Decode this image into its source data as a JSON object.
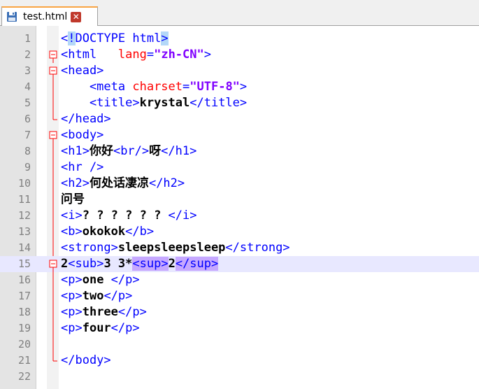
{
  "tab": {
    "label": "test.html",
    "close_glyph": "✕",
    "icon": "save-disk-icon"
  },
  "colors": {
    "tag": "#0000ff",
    "attribute": "#ff0000",
    "value": "#8000ff",
    "fold": "#ff0000",
    "current_line": "#e8e8ff"
  },
  "editor": {
    "current_line": 15,
    "lines": [
      {
        "n": "1",
        "fold": "",
        "segments": [
          {
            "c": "tg",
            "t": "<"
          },
          {
            "c": "tg hlbracket",
            "t": "!"
          },
          {
            "c": "tg",
            "t": ""
          },
          {
            "c": "tg",
            "t": "DOCTYPE html"
          },
          {
            "c": "tg hlbracket",
            "t": ">"
          }
        ]
      },
      {
        "n": "2",
        "fold": "box",
        "segments": [
          {
            "c": "tg",
            "t": "<html   "
          },
          {
            "c": "at",
            "t": "lang"
          },
          {
            "c": "tg",
            "t": "="
          },
          {
            "c": "av",
            "t": "\"zh-CN\""
          },
          {
            "c": "tg",
            "t": ">"
          }
        ]
      },
      {
        "n": "3",
        "fold": "box",
        "segments": [
          {
            "c": "tg",
            "t": "<head>"
          }
        ]
      },
      {
        "n": "4",
        "fold": "line",
        "segments": [
          {
            "c": "tg",
            "t": "    <meta "
          },
          {
            "c": "at",
            "t": "charset"
          },
          {
            "c": "tg",
            "t": "="
          },
          {
            "c": "av",
            "t": "\"UTF-8\""
          },
          {
            "c": "tg",
            "t": ">"
          }
        ]
      },
      {
        "n": "5",
        "fold": "line",
        "segments": [
          {
            "c": "tg",
            "t": "    <title>"
          },
          {
            "c": "b",
            "t": "krystal"
          },
          {
            "c": "tg",
            "t": "</title>"
          }
        ]
      },
      {
        "n": "6",
        "fold": "end",
        "segments": [
          {
            "c": "tg",
            "t": "</head>"
          }
        ]
      },
      {
        "n": "7",
        "fold": "box",
        "segments": [
          {
            "c": "tg",
            "t": "<body>"
          }
        ]
      },
      {
        "n": "8",
        "fold": "line",
        "segments": [
          {
            "c": "tg",
            "t": "<h1>"
          },
          {
            "c": "b",
            "t": "你好"
          },
          {
            "c": "tg",
            "t": "<br/>"
          },
          {
            "c": "b",
            "t": "呀"
          },
          {
            "c": "tg",
            "t": "</h1>"
          }
        ]
      },
      {
        "n": "9",
        "fold": "line",
        "segments": [
          {
            "c": "tg",
            "t": "<hr />"
          }
        ]
      },
      {
        "n": "10",
        "fold": "line",
        "segments": [
          {
            "c": "tg",
            "t": "<h2>"
          },
          {
            "c": "b",
            "t": "何处话凄凉"
          },
          {
            "c": "tg",
            "t": "</h2>"
          }
        ]
      },
      {
        "n": "11",
        "fold": "line",
        "segments": [
          {
            "c": "b",
            "t": "问号"
          }
        ]
      },
      {
        "n": "12",
        "fold": "line",
        "segments": [
          {
            "c": "tg",
            "t": "<i>"
          },
          {
            "c": "b",
            "t": "? ? ? ? ? ? "
          },
          {
            "c": "tg",
            "t": "</i>"
          }
        ]
      },
      {
        "n": "13",
        "fold": "line",
        "segments": [
          {
            "c": "tg",
            "t": "<b>"
          },
          {
            "c": "b",
            "t": "okokok"
          },
          {
            "c": "tg",
            "t": "</b>"
          }
        ]
      },
      {
        "n": "14",
        "fold": "line",
        "segments": [
          {
            "c": "tg",
            "t": "<strong>"
          },
          {
            "c": "b",
            "t": "sleepsleepsleep"
          },
          {
            "c": "tg",
            "t": "</strong>"
          }
        ]
      },
      {
        "n": "15",
        "fold": "box",
        "segments": [
          {
            "c": "b",
            "t": "2"
          },
          {
            "c": "tg",
            "t": "<sub>"
          },
          {
            "c": "b",
            "t": "3 3*"
          },
          {
            "c": "tg hlpurple",
            "t": "<sup>"
          },
          {
            "c": "b",
            "t": "2"
          },
          {
            "c": "tg hlpurple",
            "t": "</sup>"
          }
        ]
      },
      {
        "n": "16",
        "fold": "line",
        "segments": [
          {
            "c": "tg",
            "t": "<p>"
          },
          {
            "c": "b",
            "t": "one "
          },
          {
            "c": "tg",
            "t": "</p>"
          }
        ]
      },
      {
        "n": "17",
        "fold": "line",
        "segments": [
          {
            "c": "tg",
            "t": "<p>"
          },
          {
            "c": "b",
            "t": "two"
          },
          {
            "c": "tg",
            "t": "</p>"
          }
        ]
      },
      {
        "n": "18",
        "fold": "line",
        "segments": [
          {
            "c": "tg",
            "t": "<p>"
          },
          {
            "c": "b",
            "t": "three"
          },
          {
            "c": "tg",
            "t": "</p>"
          }
        ]
      },
      {
        "n": "19",
        "fold": "line",
        "segments": [
          {
            "c": "tg",
            "t": "<p>"
          },
          {
            "c": "b",
            "t": "four"
          },
          {
            "c": "tg",
            "t": "</p>"
          }
        ]
      },
      {
        "n": "20",
        "fold": "line",
        "segments": []
      },
      {
        "n": "21",
        "fold": "end",
        "segments": [
          {
            "c": "tg",
            "t": "</body>"
          }
        ]
      },
      {
        "n": "22",
        "fold": "",
        "segments": []
      }
    ]
  }
}
